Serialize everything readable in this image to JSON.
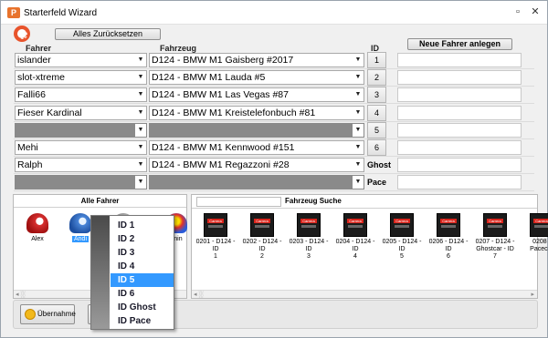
{
  "window": {
    "title": "Starterfeld Wizard",
    "app_icon_letter": "P"
  },
  "toolbar": {
    "reset_label": "Alles Zurücksetzen",
    "new_driver_label": "Neue Fahrer anlegen"
  },
  "columns": {
    "fahrer": "Fahrer",
    "fahrzeug": "Fahrzeug",
    "id": "ID"
  },
  "rows": [
    {
      "driver": "islander",
      "car": "D124 - BMW M1 Gaisberg #2017",
      "id": "1"
    },
    {
      "driver": "slot-xtreme",
      "car": "D124 - BMW M1 Lauda #5",
      "id": "2"
    },
    {
      "driver": "Falli66",
      "car": "D124 - BMW M1 Las Vegas #87",
      "id": "3"
    },
    {
      "driver": "Fieser Kardinal",
      "car": "D124 - BMW M1 Kreistelefonbuch #81",
      "id": "4"
    },
    {
      "driver": "",
      "car": "",
      "id": "5"
    },
    {
      "driver": "Mehi",
      "car": "D124 - BMW M1 Kennwood #151",
      "id": "6"
    },
    {
      "driver": "Ralph",
      "car": "D124 - BMW M1 Regazzoni #28",
      "id": "Ghost"
    },
    {
      "driver": "",
      "car": "",
      "id": "Pace"
    }
  ],
  "all_drivers": {
    "header": "Alle Fahrer",
    "drivers": [
      "Alex",
      "Andi",
      "",
      "anin"
    ]
  },
  "vehicle_search": {
    "label": "Fahrzeug Suche",
    "value": ""
  },
  "cars": [
    {
      "line1": "0201 - D124 - ID",
      "line2": "1"
    },
    {
      "line1": "0202 - D124 - ID",
      "line2": "2"
    },
    {
      "line1": "0203 - D124 - ID",
      "line2": "3"
    },
    {
      "line1": "0204 - D124 - ID",
      "line2": "4"
    },
    {
      "line1": "0205 - D124 - ID",
      "line2": "5"
    },
    {
      "line1": "0206 - D124 - ID",
      "line2": "6"
    },
    {
      "line1": "0207 - D124 -",
      "line2": "Ghostcar - ID 7"
    },
    {
      "line1": "0208 -",
      "line2": "Pacecar"
    }
  ],
  "thumb_brand": "Carrera",
  "context_menu": {
    "items": [
      "ID 1",
      "ID 2",
      "ID 3",
      "ID 4",
      "ID 5",
      "ID 6",
      "ID Ghost",
      "ID Pace"
    ],
    "selected": "ID 5"
  },
  "footer": {
    "accept_label": "Übernahme"
  },
  "colors": {
    "accent": "#3399ff",
    "brand_red": "#d9241b",
    "ring": "#e8542c"
  }
}
